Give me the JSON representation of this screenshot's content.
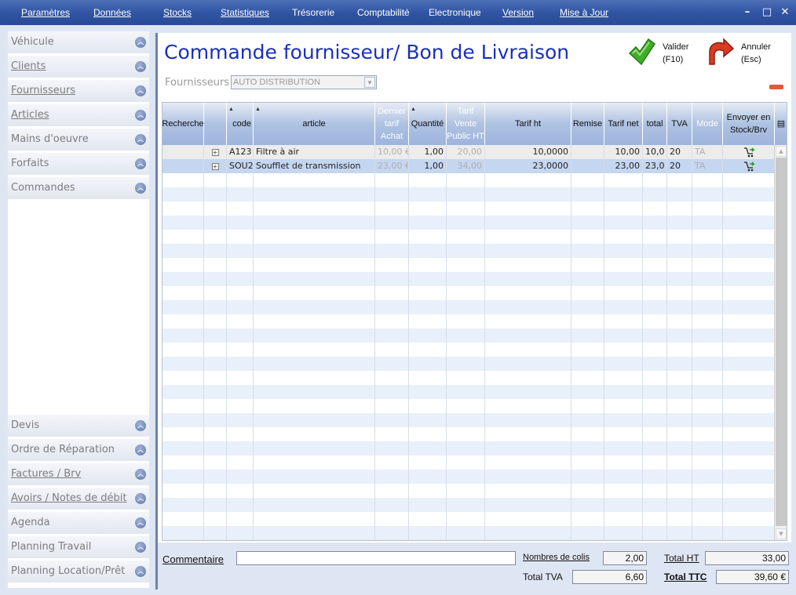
{
  "menu": [
    "Paramètres",
    "Données",
    "Stocks",
    "Statistiques",
    "Trésorerie",
    "Comptabilité",
    "Electronique",
    "Version",
    "Mise à Jour"
  ],
  "window_controls": {
    "minimize": "–",
    "maximize": "□",
    "close": "✕"
  },
  "sidebar": {
    "top_items": [
      "Véhicule",
      "Clients",
      "Fournisseurs",
      "Articles",
      "Mains d'oeuvre",
      "Forfaits",
      "Commandes"
    ],
    "bottom_items": [
      "Devis",
      "Ordre de Réparation",
      "Factures / Brv",
      "Avoirs / Notes de débit",
      "Agenda",
      "Planning Travail",
      "Planning Location/Prêt"
    ],
    "chevron_icon": "chevron-up-icon"
  },
  "main": {
    "title": "Commande fournisseur/ Bon de Livraison",
    "fournisseurs_label": "Fournisseurs",
    "fournisseur_value": "AUTO DISTRIBUTION",
    "valider": {
      "label": "Valider",
      "shortcut": "(F10)",
      "icon": "green-check-arrow-icon"
    },
    "annuler": {
      "label": "Annuler",
      "shortcut": "(Esc)",
      "icon": "red-undo-arrow-icon"
    }
  },
  "grid": {
    "headers": [
      {
        "key": "recherche",
        "label": "Recherche"
      },
      {
        "key": "blank",
        "label": ""
      },
      {
        "key": "code",
        "label": "code"
      },
      {
        "key": "article",
        "label": "article"
      },
      {
        "key": "dernier",
        "label": "Dernier tarif Achat"
      },
      {
        "key": "quantite",
        "label": "Quantité"
      },
      {
        "key": "tarif_vente",
        "label": "Tarif Vente Public HT"
      },
      {
        "key": "tarif_ht",
        "label": "Tarif ht"
      },
      {
        "key": "remise",
        "label": "Remise"
      },
      {
        "key": "tarif_net",
        "label": "Tarif net"
      },
      {
        "key": "total",
        "label": "total"
      },
      {
        "key": "tva",
        "label": "TVA"
      },
      {
        "key": "mode",
        "label": "Mode"
      },
      {
        "key": "envoyer",
        "label": "Envoyer en Stock/Brv"
      }
    ],
    "rows": [
      {
        "code": "A123",
        "article": "Filtre à air",
        "dernier": "10,00 €",
        "quantite": "1,00",
        "tarif_vente": "20,00",
        "tarif_ht": "10,0000",
        "remise": "",
        "tarif_net": "10,00",
        "total": "10,0",
        "tva": "20",
        "mode": "TA"
      },
      {
        "code": "SOU2",
        "article": "Soufflet de transmission",
        "dernier": "23,00 €",
        "quantite": "1,00",
        "tarif_vente": "34,00",
        "tarif_ht": "23,0000",
        "remise": "",
        "tarif_net": "23,00",
        "total": "23,0",
        "tva": "20",
        "mode": "TA"
      }
    ]
  },
  "footer": {
    "commentaire_label": "Commentaire",
    "commentaire_value": "",
    "colis_label": "Nombres de colis",
    "colis_value": "2,00",
    "total_ht_label": "Total HT",
    "total_ht_value": "33,00",
    "total_tva_label": "Total TVA",
    "total_tva_value": "6,60",
    "total_ttc_label": "Total TTC",
    "total_ttc_value": "39,60 €"
  }
}
